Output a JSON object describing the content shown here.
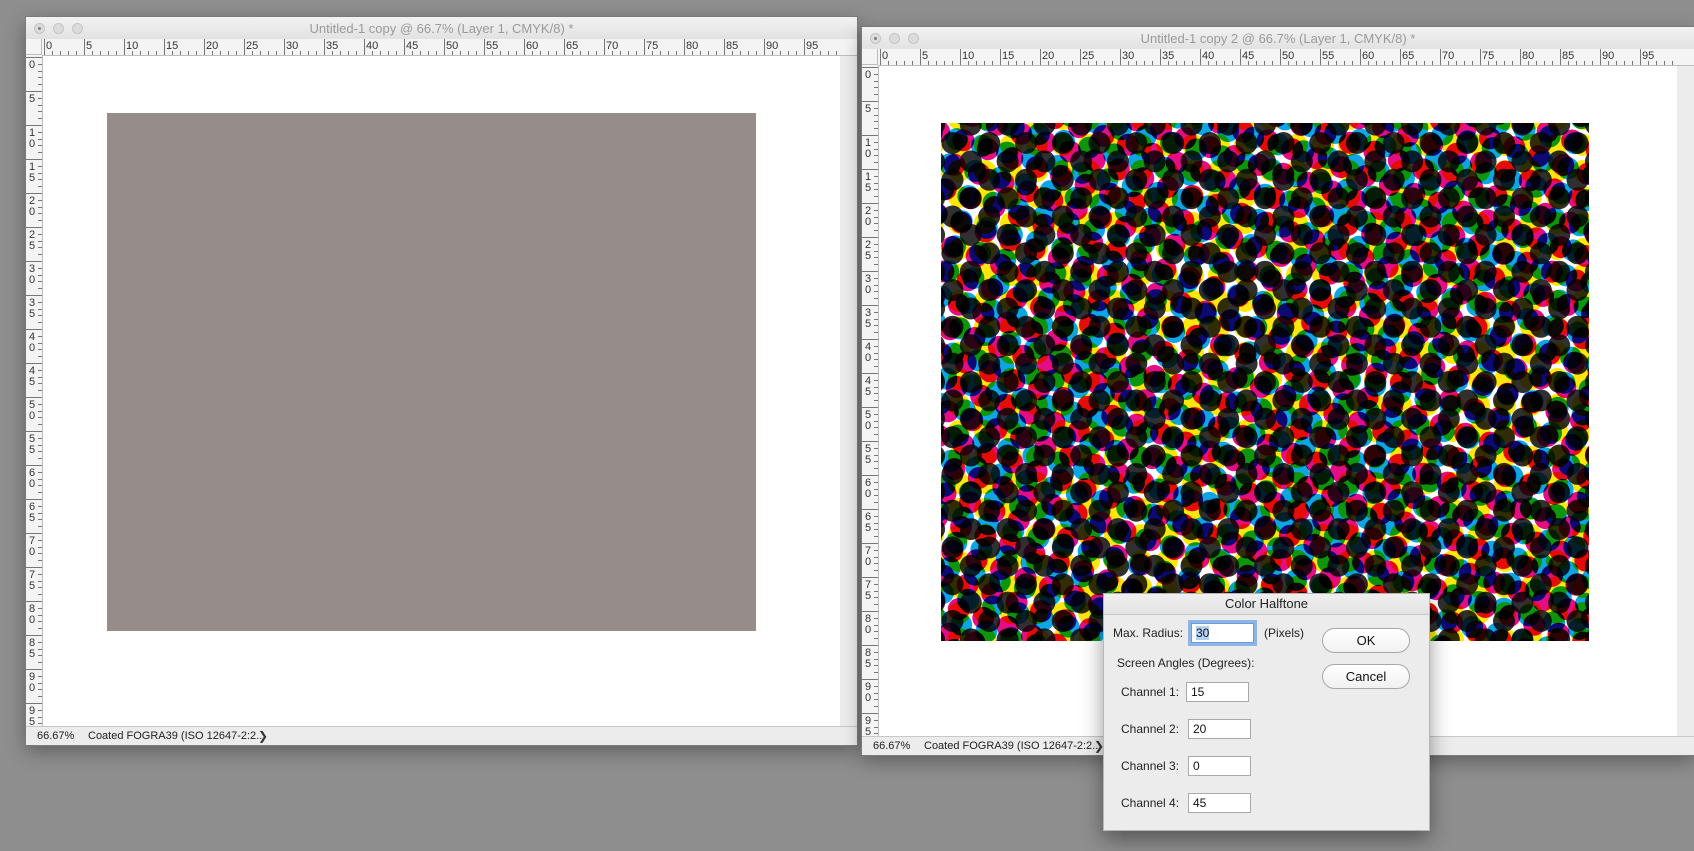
{
  "window_left": {
    "title": "Untitled-1 copy @ 66.7% (Layer 1, CMYK/8) *",
    "zoom": "66.67%",
    "profile": "Coated FOGRA39 (ISO 12647-2:2...",
    "chevron": "❯",
    "ruler_top": [
      "0",
      "5",
      "10",
      "15",
      "20",
      "25",
      "30",
      "35",
      "40",
      "45",
      "50",
      "55",
      "60",
      "65",
      "70",
      "75",
      "80",
      "85",
      "90",
      "95"
    ],
    "ruler_left": [
      "0",
      "5",
      "1 0",
      "1 5",
      "2 0",
      "2 5",
      "3 0",
      "3 5",
      "4 0",
      "4 5",
      "5 0",
      "5 5",
      "6 0",
      "6 5",
      "7 0",
      "7 5",
      "8 0",
      "8 5",
      "9 0",
      "9 5"
    ],
    "fill_color": "#968c89"
  },
  "window_right": {
    "title": "Untitled-1 copy 2 @ 66.7% (Layer 1, CMYK/8) *",
    "zoom": "66.67%",
    "profile": "Coated FOGRA39 (ISO 12647-2:2...",
    "chevron": "❯",
    "ruler_top": [
      "0",
      "5",
      "10",
      "15",
      "20",
      "25",
      "30",
      "35",
      "40",
      "45",
      "50",
      "55",
      "60",
      "65",
      "70",
      "75",
      "80",
      "85",
      "90",
      "95"
    ],
    "ruler_left": [
      "0",
      "5",
      "1 0",
      "1 5",
      "2 0",
      "2 5",
      "3 0",
      "3 5",
      "4 0",
      "4 5",
      "5 0",
      "5 5",
      "6 0",
      "6 5",
      "7 0",
      "7 5",
      "8 0",
      "8 5",
      "9 0",
      "9 5"
    ],
    "halftone_colors": [
      "#00a0e0",
      "#e4007c",
      "#ffe600",
      "#1a1a1a"
    ]
  },
  "dialog": {
    "title": "Color Halftone",
    "max_radius_label": "Max. Radius:",
    "max_radius_value": "30",
    "units": "(Pixels)",
    "screen_angles_label": "Screen Angles (Degrees):",
    "channels": [
      {
        "label": "Channel 1:",
        "value": "15"
      },
      {
        "label": "Channel 2:",
        "value": "20"
      },
      {
        "label": "Channel 3:",
        "value": "0"
      },
      {
        "label": "Channel 4:",
        "value": "45"
      }
    ],
    "ok_label": "OK",
    "cancel_label": "Cancel"
  }
}
